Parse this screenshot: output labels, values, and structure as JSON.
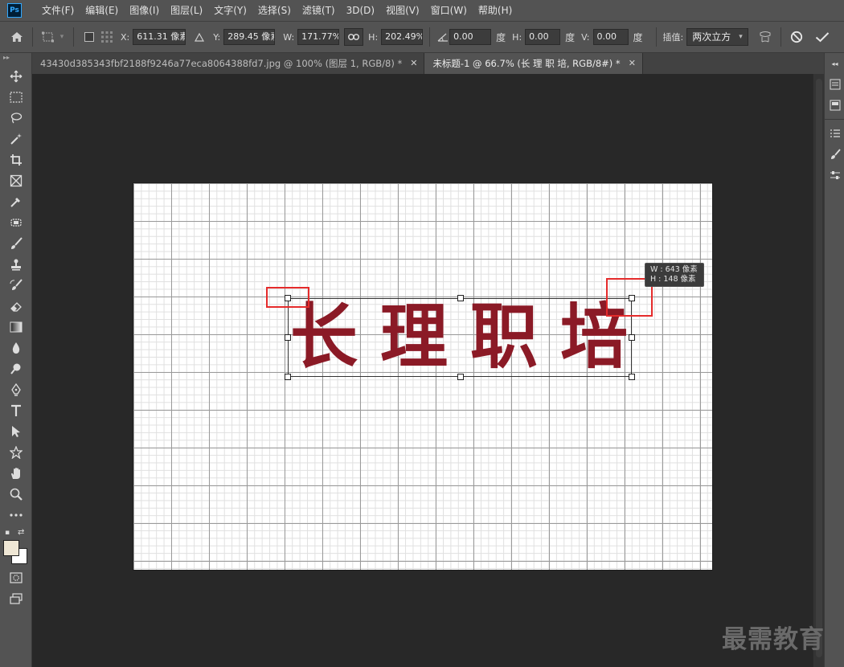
{
  "app": {
    "logo": "Ps"
  },
  "menu": [
    "文件(F)",
    "编辑(E)",
    "图像(I)",
    "图层(L)",
    "文字(Y)",
    "选择(S)",
    "滤镜(T)",
    "3D(D)",
    "视图(V)",
    "窗口(W)",
    "帮助(H)"
  ],
  "options": {
    "x_label": "X:",
    "x_value": "611.31 像素",
    "y_label": "Y:",
    "y_value": "289.45 像素",
    "w_label": "W:",
    "w_value": "171.77%",
    "h_label": "H:",
    "h_value": "202.49%",
    "angle_value": "0.00",
    "angle_unit": "度",
    "hskew_label": "H:",
    "hskew_value": "0.00",
    "hskew_unit": "度",
    "vskew_label": "V:",
    "vskew_value": "0.00",
    "vskew_unit": "度",
    "interp_label": "插值:",
    "interp_value": "两次立方"
  },
  "tabs": [
    {
      "label": "43430d385343fbf2188f9246a77eca8064388fd7.jpg @ 100% (图层 1, RGB/8) *",
      "active": false
    },
    {
      "label": "未标题-1 @ 66.7% (长 理 职 培, RGB/8#) *",
      "active": true
    }
  ],
  "canvas": {
    "chars": [
      "长",
      "理",
      "职",
      "培"
    ],
    "text_color": "#8b1a26"
  },
  "tooltip": {
    "w_line": "W : 643 像素",
    "h_line": "H : 148 像素"
  },
  "watermark": "最需教育",
  "colors": {
    "accent_highlight": "#e52b2b",
    "foreground": "#efe7d5",
    "background": "#ffffff"
  }
}
